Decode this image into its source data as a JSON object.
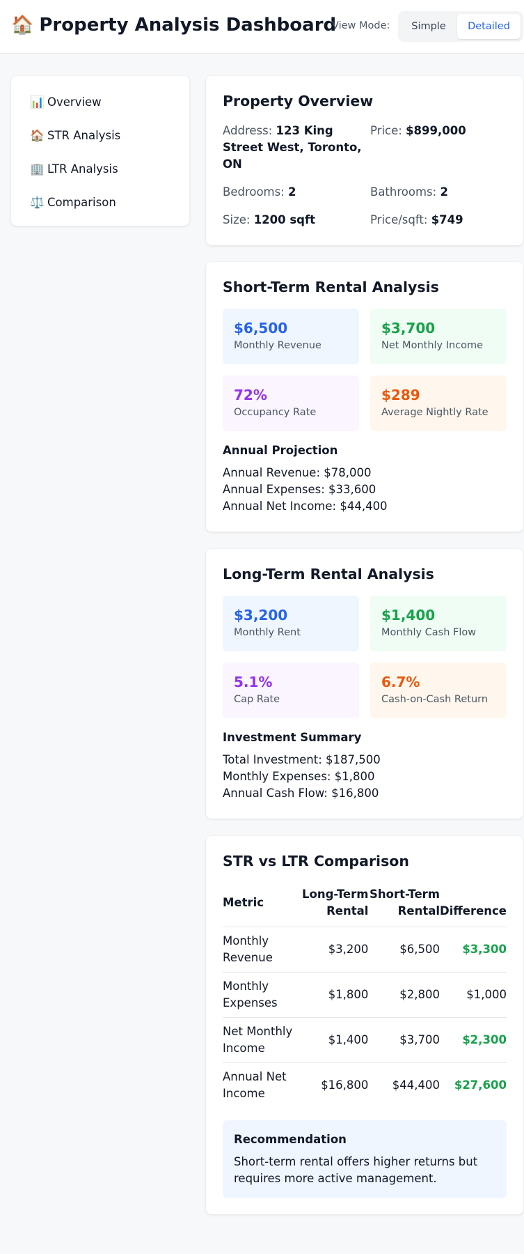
{
  "header": {
    "icon": "🏠",
    "title": "Property Analysis Dashboard",
    "view_mode_label": "View Mode:",
    "view_mode_options": [
      "Simple",
      "Detailed"
    ],
    "view_mode_selected": "Detailed",
    "accent_color": "#2563eb"
  },
  "sidebar": {
    "items": [
      {
        "icon": "📊",
        "icon_name": "bar-chart-icon",
        "label": "Overview"
      },
      {
        "icon": "🏠",
        "icon_name": "house-icon",
        "label": "STR Analysis"
      },
      {
        "icon": "🏢",
        "icon_name": "office-building-icon",
        "label": "LTR Analysis"
      },
      {
        "icon": "⚖️",
        "icon_name": "scales-icon",
        "label": "Comparison"
      }
    ]
  },
  "overview": {
    "title": "Property Overview",
    "fields": [
      {
        "label": "Address:",
        "value": "123 King Street West, Toronto, ON"
      },
      {
        "label": "Price:",
        "value": "$899,000"
      },
      {
        "label": "Bedrooms:",
        "value": "2"
      },
      {
        "label": "Bathrooms:",
        "value": "2"
      },
      {
        "label": "Size:",
        "value": "1200 sqft"
      },
      {
        "label": "Price/sqft:",
        "value": "$749"
      }
    ]
  },
  "str": {
    "title": "Short-Term Rental Analysis",
    "metrics": [
      {
        "value": "$6,500",
        "label": "Monthly Revenue"
      },
      {
        "value": "$3,700",
        "label": "Net Monthly Income"
      },
      {
        "value": "72%",
        "label": "Occupancy Rate"
      },
      {
        "value": "$289",
        "label": "Average Nightly Rate"
      }
    ],
    "section_title": "Annual Projection",
    "lines": [
      "Annual Revenue: $78,000",
      "Annual Expenses: $33,600",
      "Annual Net Income: $44,400"
    ]
  },
  "ltr": {
    "title": "Long-Term Rental Analysis",
    "metrics": [
      {
        "value": "$3,200",
        "label": "Monthly Rent"
      },
      {
        "value": "$1,400",
        "label": "Monthly Cash Flow"
      },
      {
        "value": "5.1%",
        "label": "Cap Rate"
      },
      {
        "value": "6.7%",
        "label": "Cash-on-Cash Return"
      }
    ],
    "section_title": "Investment Summary",
    "lines": [
      "Total Investment: $187,500",
      "Monthly Expenses: $1,800",
      "Annual Cash Flow: $16,800"
    ]
  },
  "comparison": {
    "title": "STR vs LTR Comparison",
    "headers": [
      "Metric",
      "Long-Term Rental",
      "Short-Term Rental",
      "Difference"
    ],
    "rows": [
      {
        "metric": "Monthly Revenue",
        "ltr": "$3,200",
        "str": "$6,500",
        "diff": "$3,300",
        "positive": true
      },
      {
        "metric": "Monthly Expenses",
        "ltr": "$1,800",
        "str": "$2,800",
        "diff": "$1,000",
        "positive": false
      },
      {
        "metric": "Net Monthly Income",
        "ltr": "$1,400",
        "str": "$3,700",
        "diff": "$2,300",
        "positive": true
      },
      {
        "metric": "Annual Net Income",
        "ltr": "$16,800",
        "str": "$44,400",
        "diff": "$27,600",
        "positive": true
      }
    ],
    "recommendation": {
      "title": "Recommendation",
      "text": "Short-term rental offers higher returns but requires more active management."
    }
  }
}
